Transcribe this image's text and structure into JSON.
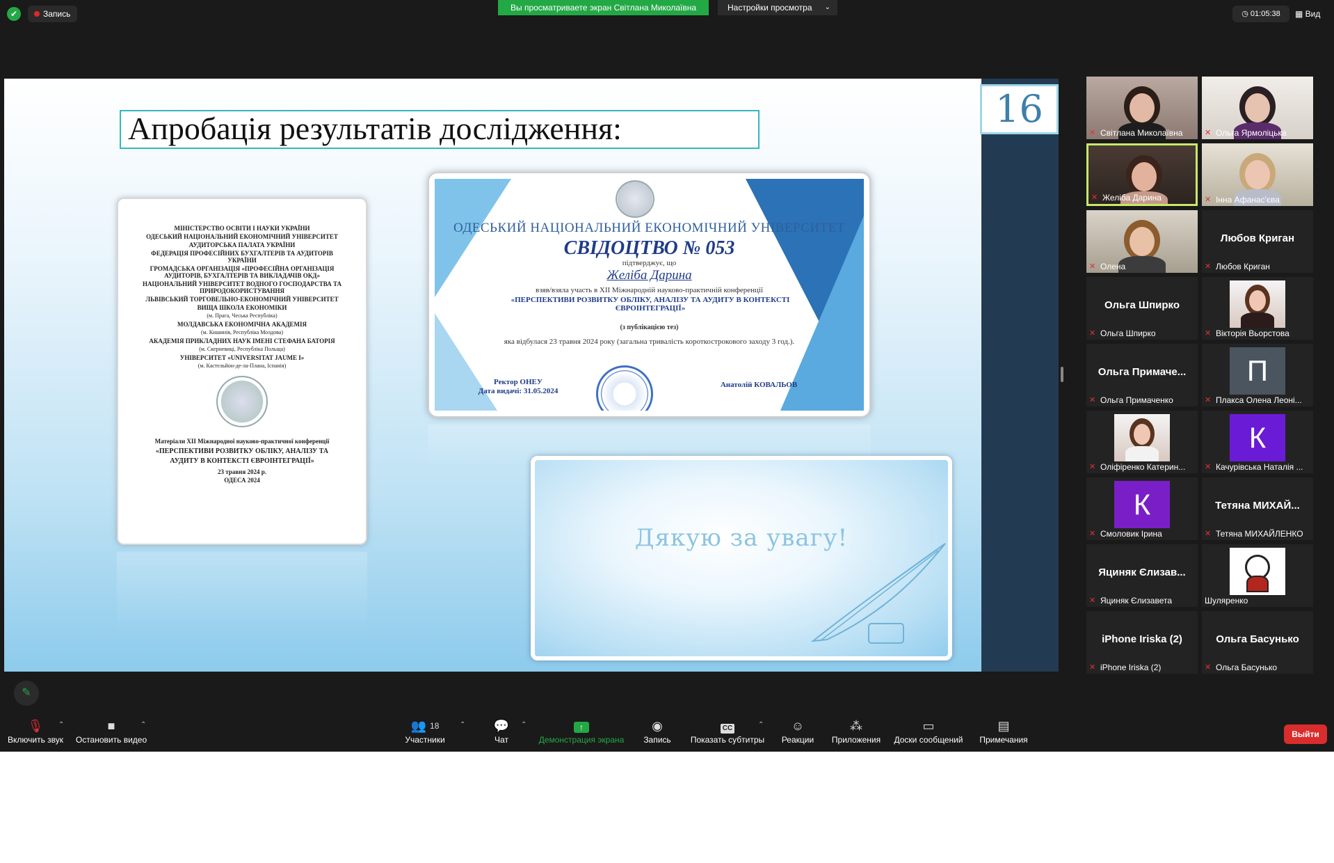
{
  "topbar": {
    "recording_label": "Запись",
    "share_banner": "Вы просматриваете экран Світлана Миколаївна",
    "view_settings": "Настройки просмотра",
    "timer": "01:05:38",
    "view_label": "Вид"
  },
  "slide": {
    "number": "16",
    "title": "Апробація результатів дослідження:",
    "booklet": {
      "lines": [
        "МІНІСТЕРСТВО ОСВІТИ І НАУКИ УКРАЇНИ",
        "ОДЕСЬКИЙ НАЦІОНАЛЬНИЙ ЕКОНОМІЧНИЙ УНІВЕРСИТЕТ",
        "АУДИТОРСЬКА ПАЛАТА УКРАЇНИ",
        "ФЕДЕРАЦІЯ ПРОФЕСІЙНИХ БУХГАЛТЕРІВ ТА АУДИТОРІВ УКРАЇНИ",
        "ГРОМАДСЬКА ОРГАНІЗАЦІЯ «ПРОФЕСІЙНА ОРГАНІЗАЦІЯ АУДИТОРІВ, БУХГАЛТЕРІВ ТА ВИКЛАДАЧІВ ОКД»",
        "НАЦІОНАЛЬНИЙ УНІВЕРСИТЕТ ВОДНОГО ГОСПОДАРСТВА ТА ПРИРОДОКОРИСТУВАННЯ",
        "ЛЬВІВСЬКИЙ ТОРГОВЕЛЬНО-ЕКОНОМІЧНИЙ УНІВЕРСИТЕТ",
        "ВИЩА ШКОЛА ЕКОНОМІКИ",
        "(м. Прага, Чеська Республіка)",
        "МОЛДАВСЬКА ЕКОНОМІЧНА АКАДЕМІЯ",
        "(м. Кишинів, Республіка Молдова)",
        "АКАДЕМІЯ ПРИКЛАДНИХ НАУК ІМЕНІ СТЕФАНА БАТОРІЯ",
        "(м. Скерневиці, Республіка Польща)",
        "УНІВЕРСИТЕТ «UNIVERSITAT JAUME I»",
        "(м. Кастельйон-де-ла-Плана, Іспанія)"
      ],
      "materials": "Матеріали XII Міжнародної науково-практичної конференції",
      "conference": "«ПЕРСПЕКТИВИ РОЗВИТКУ ОБЛІКУ, АНАЛІЗУ ТА АУДИТУ В КОНТЕКСТІ ЄВРОІНТЕГРАЦІЇ»",
      "date": "23 травня 2024 р.",
      "city": "ОДЕСА 2024"
    },
    "certificate": {
      "university": "ОДЕСЬКИЙ НАЦІОНАЛЬНИЙ ЕКОНОМІЧНИЙ УНІВЕРСИТЕТ",
      "number": "СВІДОЦТВО № 053",
      "confirms": "підтверджує, що",
      "name": "Желіба Дарина",
      "took_part": "взяв/взяла участь в XII Міжнародній науково-практичній конференції",
      "conference": "«ПЕРСПЕКТИВИ РОЗВИТКУ ОБЛІКУ, АНАЛІЗУ ТА АУДИТУ В КОНТЕКСТІ ЄВРОІНТЕГРАЦІЇ»",
      "publication": "(з публікацією тез)",
      "held": "яка відбулася 23 травня 2024 року (загальна тривалість короткострокового заходу 3 год.).",
      "rector": "Ректор ОНЕУ",
      "issued": "Дата видачі: 31.05.2024",
      "signatory": "Анатолій КОВАЛЬОВ"
    },
    "thanks": "Дякую за увагу!"
  },
  "participants": [
    {
      "name": "Світлана Миколаївна",
      "type": "video"
    },
    {
      "name": "Ольга Ярмоліцька",
      "type": "video"
    },
    {
      "name": "Желіба Дарина",
      "type": "video",
      "active": true
    },
    {
      "name": "Інна Афанас'єва",
      "type": "video"
    },
    {
      "name": "Олена",
      "type": "video"
    },
    {
      "name": "Любов Криган",
      "type": "name",
      "display": "Любов Криган"
    },
    {
      "name": "Ольга Шпирко",
      "type": "name",
      "display": "Ольга Шпирко"
    },
    {
      "name": "Вікторія Вьорстова",
      "type": "photo"
    },
    {
      "name": "Ольга Примаченко",
      "type": "name",
      "display": "Ольга Примаче..."
    },
    {
      "name": "Плакса Олена Леоні...",
      "type": "avatar",
      "letter": "П",
      "color": "#4a5560"
    },
    {
      "name": "Оліфіренко Катерин...",
      "type": "photo"
    },
    {
      "name": "Качурівська Наталія ...",
      "type": "avatar",
      "letter": "К",
      "color": "#6a1bd6"
    },
    {
      "name": "Смоловик Ірина",
      "type": "avatar",
      "letter": "К",
      "color": "#7a1fc8"
    },
    {
      "name": "Тетяна МИХАЙЛЕНКО",
      "type": "name",
      "display": "Тетяна МИХАЙ..."
    },
    {
      "name": "Яциняк Єлизавета",
      "type": "name",
      "display": "Яциняк Єлизав..."
    },
    {
      "name": "Шуляренко",
      "type": "photo"
    },
    {
      "name": "iPhone Iriska (2)",
      "type": "name",
      "display": "iPhone Iriska (2)"
    },
    {
      "name": "Ольга Басунько",
      "type": "name",
      "display": "Ольга Басунько"
    }
  ],
  "toolbar": {
    "unmute": "Включить звук",
    "stop_video": "Остановить видео",
    "participants": "Участники",
    "participants_count": "18",
    "chat": "Чат",
    "share": "Демонстрация экрана",
    "record": "Запись",
    "captions": "Показать субтитры",
    "reactions": "Реакции",
    "apps": "Приложения",
    "whiteboards": "Доски сообщений",
    "notes": "Примечания",
    "leave": "Выйти"
  },
  "colors": {
    "accent_green": "#23a846",
    "leave_red": "#d92d2d",
    "active_speaker": "#c8e86a"
  }
}
